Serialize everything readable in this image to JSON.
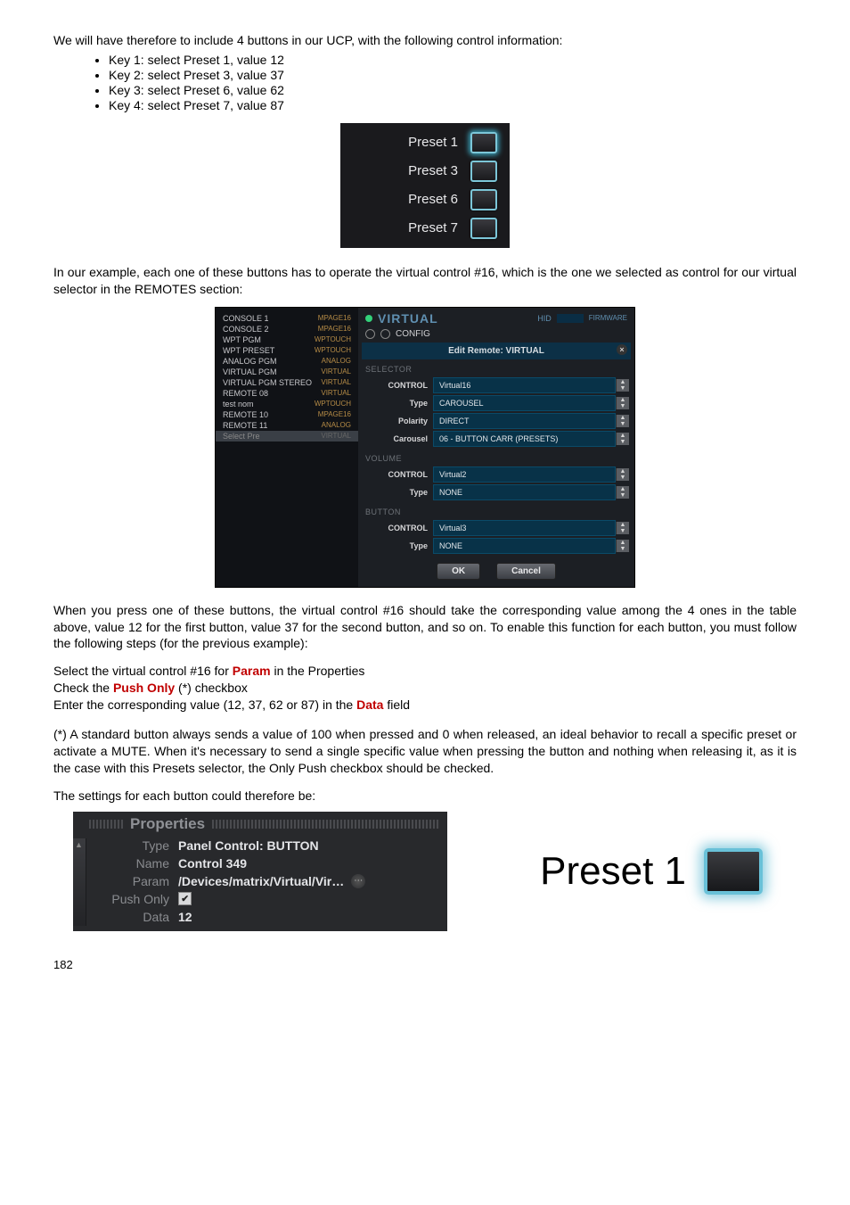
{
  "intro_line": "We will have therefore to include 4 buttons in our UCP, with the following control information:",
  "keys": [
    "Key 1: select Preset 1, value 12",
    "Key 2: select Preset 3, value 37",
    "Key 3: select Preset 6, value 62",
    "Key 4: select Preset 7, value 87"
  ],
  "fig1": {
    "presets": [
      "Preset 1",
      "Preset 3",
      "Preset 6",
      "Preset 7"
    ]
  },
  "para2": "In our example, each one of these buttons has to operate the virtual control #16, which is the one we selected as control for our virtual selector in the REMOTES section:",
  "fig2": {
    "side": [
      {
        "name": "CONSOLE 1",
        "tag": "MPAGE16"
      },
      {
        "name": "CONSOLE 2",
        "tag": "MPAGE16"
      },
      {
        "name": "WPT PGM",
        "tag": "WPTOUCH"
      },
      {
        "name": "WPT PRESET",
        "tag": "WPTOUCH"
      },
      {
        "name": "ANALOG PGM",
        "tag": "ANALOG"
      },
      {
        "name": "VIRTUAL PGM",
        "tag": "VIRTUAL"
      },
      {
        "name": "VIRTUAL PGM STEREO",
        "tag": "VIRTUAL"
      },
      {
        "name": "REMOTE 08",
        "tag": "VIRTUAL"
      },
      {
        "name": "test nom",
        "tag": "WPTOUCH"
      },
      {
        "name": "REMOTE 10",
        "tag": "MPAGE16"
      },
      {
        "name": "REMOTE 11",
        "tag": "ANALOG"
      },
      {
        "name": "Select Pre",
        "tag": "VIRTUAL"
      }
    ],
    "header_title": "VIRTUAL",
    "header_hid": "HID",
    "header_fw": "FIRMWARE",
    "sub_config": "CONFIG",
    "edit_title": "Edit Remote: VIRTUAL",
    "sections": {
      "selector": {
        "label": "SELECTOR",
        "rows": [
          {
            "lbl": "CONTROL",
            "val": "Virtual16"
          },
          {
            "lbl": "Type",
            "val": "CAROUSEL"
          },
          {
            "lbl": "Polarity",
            "val": "DIRECT"
          },
          {
            "lbl": "Carousel",
            "val": "06 - BUTTON CARR (PRESETS)"
          }
        ]
      },
      "volume": {
        "label": "VOLUME",
        "rows": [
          {
            "lbl": "CONTROL",
            "val": "Virtual2"
          },
          {
            "lbl": "Type",
            "val": "NONE"
          }
        ]
      },
      "button": {
        "label": "BUTTON",
        "rows": [
          {
            "lbl": "CONTROL",
            "val": "Virtual3"
          },
          {
            "lbl": "Type",
            "val": "NONE"
          }
        ]
      }
    },
    "ok": "OK",
    "cancel": "Cancel"
  },
  "para3": "When you press one of these buttons, the virtual control #16 should take the corresponding value among the 4 ones in the table above, value 12 for the first button, value 37 for the second button, and so on. To enable this function for each button, you must follow the following steps (for the previous example):",
  "steps": {
    "line1_a": "Select the virtual control #16 for ",
    "line1_b": "Param",
    "line1_c": " in the Properties",
    "line2_a": "Check the ",
    "line2_b": "Push Only",
    "line2_c": " (*) checkbox",
    "line3_a": "Enter the corresponding value (12, 37, 62 or 87) in the ",
    "line3_b": "Data",
    "line3_c": " field"
  },
  "para4": "(*) A standard button always sends a value of 100 when pressed and 0 when released, an ideal behavior to recall a specific preset or activate a MUTE. When it's necessary to send a single specific value when pressing the button and nothing when releasing it, as it is the case with this Presets selector, the Only Push checkbox should be checked.",
  "para5": "The settings for each button could therefore be:",
  "fig3": {
    "title": "Properties",
    "rows": {
      "type_lbl": "Type",
      "type_val": "Panel Control: BUTTON",
      "name_lbl": "Name",
      "name_val": "Control 349",
      "param_lbl": "Param",
      "param_val": "/Devices/matrix/Virtual/Vir…",
      "push_lbl": "Push Only",
      "data_lbl": "Data",
      "data_val": "12"
    },
    "preset_label": "Preset 1"
  },
  "page_number": "182"
}
